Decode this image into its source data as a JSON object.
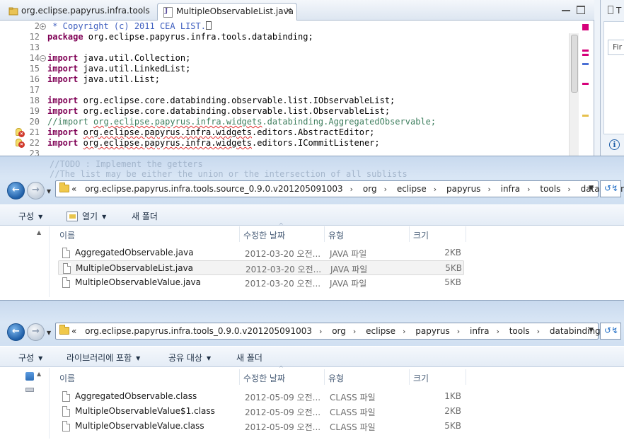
{
  "eclipse": {
    "tabs": [
      {
        "label": "org.eclipse.papyrus.infra.tools",
        "active": false
      },
      {
        "label": "MultipleObservableList.java",
        "active": true,
        "close": "✕"
      }
    ],
    "side_panel": {
      "title_fragment": "T",
      "find_fragment": "Fir"
    },
    "lines": [
      {
        "n": "2",
        "fold": true,
        "html": "<span class=\"cm\"> * Copyright (c) 2011 CEA LIST.</span><span class=\"cursorbox\"></span>"
      },
      {
        "n": "12",
        "html": "<span class=\"kw\">package</span> org.eclipse.papyrus.infra.tools.databinding;"
      },
      {
        "n": "13",
        "html": ""
      },
      {
        "n": "14",
        "fold": true,
        "html": "<span class=\"kw\">import</span> java.util.Collection;"
      },
      {
        "n": "15",
        "html": "<span class=\"kw\">import</span> java.util.LinkedList;"
      },
      {
        "n": "16",
        "html": "<span class=\"kw\">import</span> java.util.List;"
      },
      {
        "n": "17",
        "html": ""
      },
      {
        "n": "18",
        "html": "<span class=\"kw\">import</span> org.eclipse.core.databinding.observable.list.IObservableList;"
      },
      {
        "n": "19",
        "html": "<span class=\"kw\">import</span> org.eclipse.core.databinding.observable.list.ObservableList;"
      },
      {
        "n": "20",
        "html": "<span class=\"cm2\">//import <span class=\"squig\">org.eclipse.papyrus.infra.widgets</span>.databinding.AggregatedObservable;</span>"
      },
      {
        "n": "21",
        "err": true,
        "html": "<span class=\"kw\">import</span> <span class=\"squig\">org.eclipse.papyrus.infra.widgets</span>.editors.AbstractEditor;"
      },
      {
        "n": "22",
        "err": true,
        "html": "<span class=\"kw\">import</span> <span class=\"squig\">org.eclipse.papyrus.infra.widgets</span>.editors.ICommitListener;"
      },
      {
        "n": "23",
        "html": ""
      }
    ],
    "ruler_colors": [
      "#d6007a",
      "#d6007a",
      "#4a6fd4",
      "#d6007a",
      "#e6c04c"
    ]
  },
  "explorer1": {
    "ghost_text": "//TODO : Implement the getters\n//The list may be either the union or the intersection of all sublists",
    "crumb_lead": "«",
    "crumbs": [
      "org.eclipse.papyrus.infra.tools.source_0.9.0.v201205091003",
      "org",
      "eclipse",
      "papyrus",
      "infra",
      "tools",
      "databinding"
    ],
    "commands": [
      "구성",
      "열기",
      "새 폴더"
    ],
    "columns": [
      "이름",
      "수정한 날짜",
      "유형",
      "크기"
    ],
    "rows": [
      {
        "name": "AggregatedObservable.java",
        "date": "2012-03-20 오전...",
        "type": "JAVA 파일",
        "size": "2KB",
        "selected": false
      },
      {
        "name": "MultipleObservableList.java",
        "date": "2012-03-20 오전...",
        "type": "JAVA 파일",
        "size": "5KB",
        "selected": true
      },
      {
        "name": "MultipleObservableValue.java",
        "date": "2012-03-20 오전...",
        "type": "JAVA 파일",
        "size": "5KB",
        "selected": false
      }
    ]
  },
  "explorer2": {
    "crumb_lead": "«",
    "crumbs": [
      "org.eclipse.papyrus.infra.tools_0.9.0.v201205091003",
      "org",
      "eclipse",
      "papyrus",
      "infra",
      "tools",
      "databinding"
    ],
    "commands": [
      "구성",
      "라이브러리에 포함",
      "공유 대상",
      "새 폴더"
    ],
    "columns": [
      "이름",
      "수정한 날짜",
      "유형",
      "크기"
    ],
    "rows": [
      {
        "name": "AggregatedObservable.class",
        "date": "2012-05-09 오전...",
        "type": "CLASS 파일",
        "size": "1KB",
        "selected": false
      },
      {
        "name": "MultipleObservableValue$1.class",
        "date": "2012-05-09 오전...",
        "type": "CLASS 파일",
        "size": "2KB",
        "selected": false
      },
      {
        "name": "MultipleObservableValue.class",
        "date": "2012-05-09 오전...",
        "type": "CLASS 파일",
        "size": "5KB",
        "selected": false
      }
    ]
  }
}
